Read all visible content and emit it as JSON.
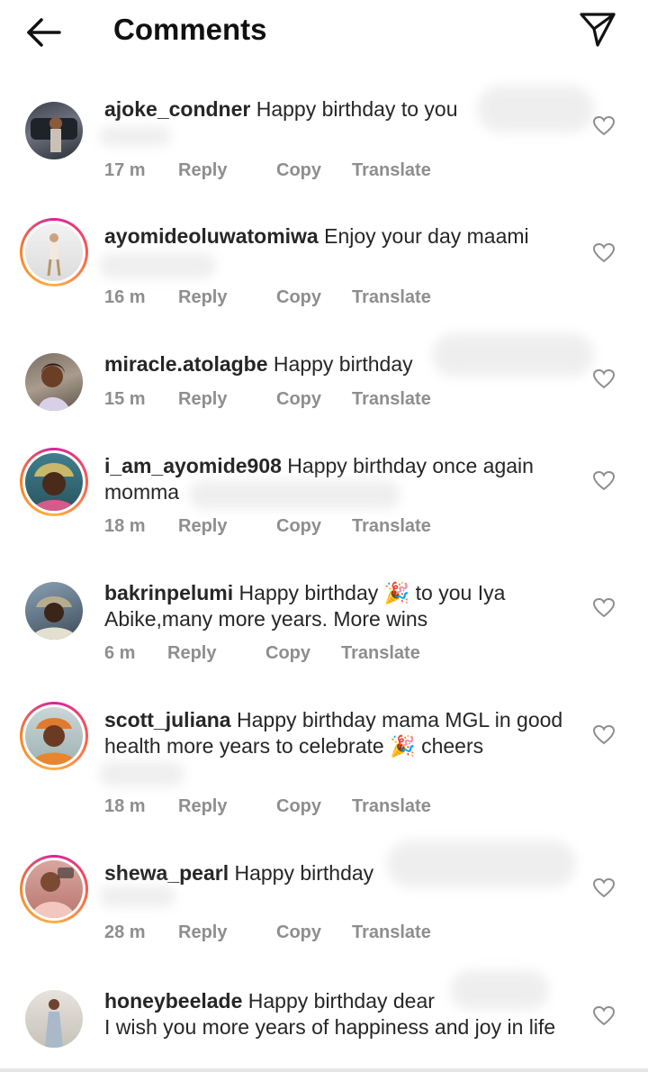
{
  "header": {
    "title": "Comments"
  },
  "actions": {
    "reply": "Reply",
    "copy": "Copy",
    "translate": "Translate"
  },
  "comments": [
    {
      "username": "ajoke_condner",
      "text": "Happy birthday to you",
      "time": "17 m"
    },
    {
      "username": "ayomideoluwatomiwa",
      "text": "Enjoy your day maami",
      "time": "16 m"
    },
    {
      "username": "miracle.atolagbe",
      "text": "Happy birthday",
      "time": "15 m"
    },
    {
      "username": "i_am_ayomide908",
      "text": "Happy birthday once again momma",
      "time": "18 m"
    },
    {
      "username": "bakrinpelumi",
      "text_before": "Happy birthday",
      "emoji": "🎉",
      "text_after": "to you Iya Abike,many more years. More wins",
      "time": "6 m"
    },
    {
      "username": "scott_juliana",
      "text_before": "Happy birthday mama MGL in good health more years to celebrate",
      "emoji": "🎉",
      "text_after": "cheers",
      "time": "18 m"
    },
    {
      "username": "shewa_pearl",
      "text": "Happy birthday",
      "time": "28 m"
    },
    {
      "username": "honeybeelade",
      "text": "Happy birthday dear",
      "text2": "I wish you more years of happiness and joy in life"
    }
  ]
}
